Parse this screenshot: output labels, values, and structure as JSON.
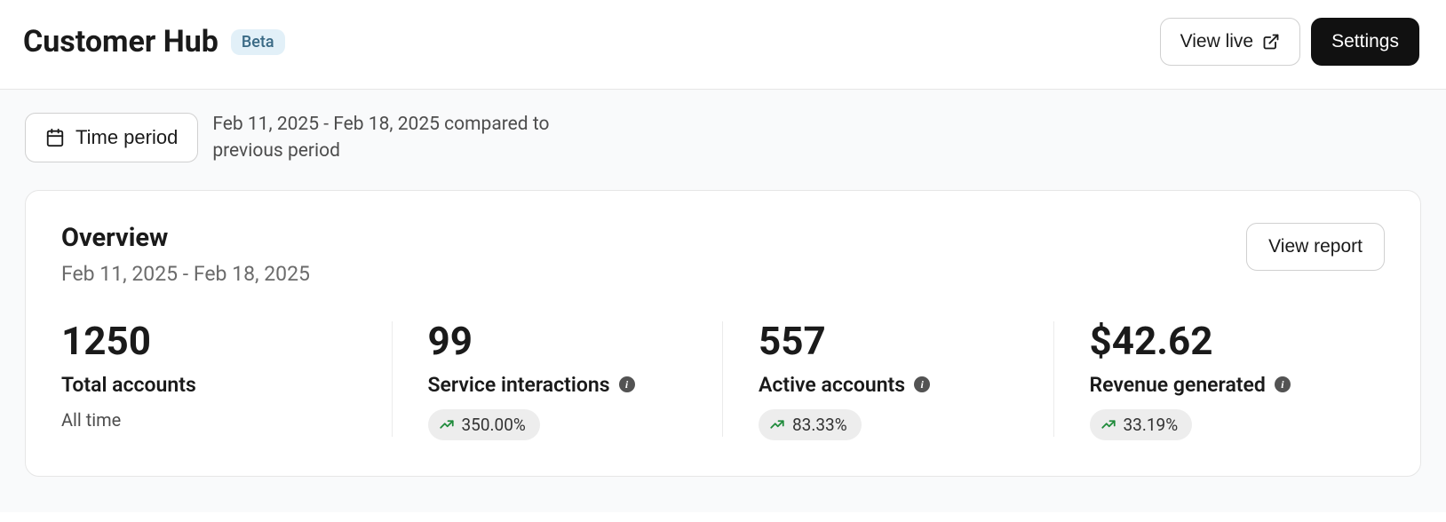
{
  "header": {
    "title": "Customer Hub",
    "badge": "Beta",
    "view_live_label": "View live",
    "settings_label": "Settings"
  },
  "filter": {
    "time_period_label": "Time period",
    "comparison_text": "Feb 11, 2025 - Feb 18, 2025 compared to previous period"
  },
  "overview": {
    "title": "Overview",
    "date_range": "Feb 11, 2025 - Feb 18, 2025",
    "view_report_label": "View report",
    "metrics": [
      {
        "value": "1250",
        "label": "Total accounts",
        "sub": "All time",
        "has_info": false,
        "has_trend": false
      },
      {
        "value": "99",
        "label": "Service interactions",
        "has_info": true,
        "has_trend": true,
        "trend": "350.00%"
      },
      {
        "value": "557",
        "label": "Active accounts",
        "has_info": true,
        "has_trend": true,
        "trend": "83.33%"
      },
      {
        "value": "$42.62",
        "label": "Revenue generated",
        "has_info": true,
        "has_trend": true,
        "trend": "33.19%"
      }
    ]
  }
}
